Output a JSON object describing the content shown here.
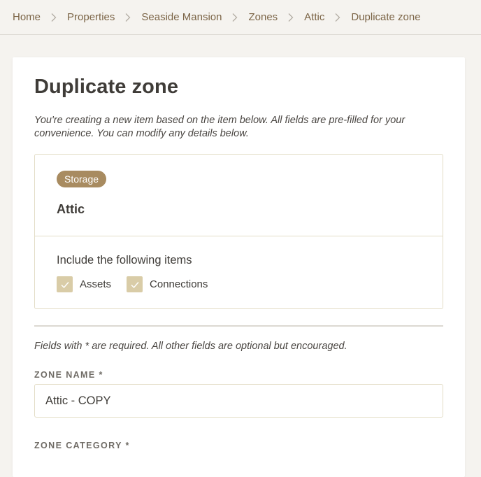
{
  "breadcrumb": {
    "items": [
      {
        "label": "Home"
      },
      {
        "label": "Properties"
      },
      {
        "label": "Seaside Mansion"
      },
      {
        "label": "Zones"
      },
      {
        "label": "Attic"
      }
    ],
    "current": "Duplicate zone",
    "separator_icon": "chevron-right-icon"
  },
  "page": {
    "title": "Duplicate zone",
    "intro": "You're creating a new item based on the item below. All fields are pre-filled for your convenience. You can modify any details below."
  },
  "source_item": {
    "badge": "Storage",
    "name": "Attic",
    "include_label": "Include the following items",
    "options": [
      {
        "label": "Assets",
        "checked": true
      },
      {
        "label": "Connections",
        "checked": true
      }
    ]
  },
  "form": {
    "required_note": "Fields with * are required. All other fields are optional but encouraged.",
    "zone_name": {
      "label": "ZONE NAME *",
      "value": "Attic - COPY"
    },
    "zone_category": {
      "label": "ZONE CATEGORY *"
    }
  },
  "colors": {
    "accent": "#a88b60",
    "link": "#7b6446",
    "checkbox": "#d9cca7",
    "border": "#e3ddc6",
    "background": "#f5f3ef"
  }
}
